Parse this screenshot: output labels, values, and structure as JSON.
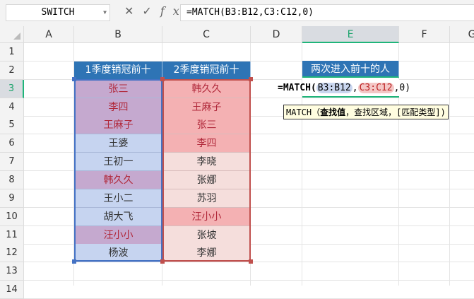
{
  "name_box": "SWITCH",
  "formula": "=MATCH(B3:B12,C3:C12,0)",
  "icons": [
    "cancel-icon",
    "confirm-icon",
    "fx-icon"
  ],
  "icon_glyphs": [
    "✕",
    "✓",
    "fx"
  ],
  "columns": [
    "A",
    "B",
    "C",
    "D",
    "E",
    "F",
    "G"
  ],
  "rows": [
    "1",
    "2",
    "3",
    "4",
    "5",
    "6",
    "7",
    "8",
    "9",
    "10",
    "11",
    "12",
    "13",
    "14"
  ],
  "headers": {
    "b": "1季度销冠前十",
    "c": "2季度销冠前十",
    "e": "两次进入前十的人"
  },
  "col_b": [
    {
      "v": "张三",
      "m": true
    },
    {
      "v": "李四",
      "m": true
    },
    {
      "v": "王麻子",
      "m": true
    },
    {
      "v": "王婆",
      "m": false
    },
    {
      "v": "王初一",
      "m": false
    },
    {
      "v": "韩久久",
      "m": true
    },
    {
      "v": "王小二",
      "m": false
    },
    {
      "v": "胡大飞",
      "m": false
    },
    {
      "v": "汪小小",
      "m": true
    },
    {
      "v": "杨波",
      "m": false
    }
  ],
  "col_c": [
    {
      "v": "韩久久",
      "m": true
    },
    {
      "v": "王麻子",
      "m": true
    },
    {
      "v": "张三",
      "m": true
    },
    {
      "v": "李四",
      "m": true
    },
    {
      "v": "李晓",
      "m": false
    },
    {
      "v": "张娜",
      "m": false
    },
    {
      "v": "苏羽",
      "m": false
    },
    {
      "v": "汪小小",
      "m": true
    },
    {
      "v": "张坡",
      "m": false
    },
    {
      "v": "李娜",
      "m": false
    }
  ],
  "edit": {
    "prefix": "=MATCH(",
    "range1": "B3:B12",
    "sep": ",",
    "range2": "C3:C12",
    "suffix": ",0)"
  },
  "tooltip": {
    "fn": "MATCH（",
    "arg1": "查找值",
    "rest": "，查找区域，[匹配类型])"
  },
  "colors": {
    "b_match": "#c5a9cf",
    "b_other": "#c6d4f0",
    "c_match": "#f4b1b3",
    "c_other": "#f5dedc",
    "header": "#2e74b5",
    "accent": "#1fb57a"
  }
}
